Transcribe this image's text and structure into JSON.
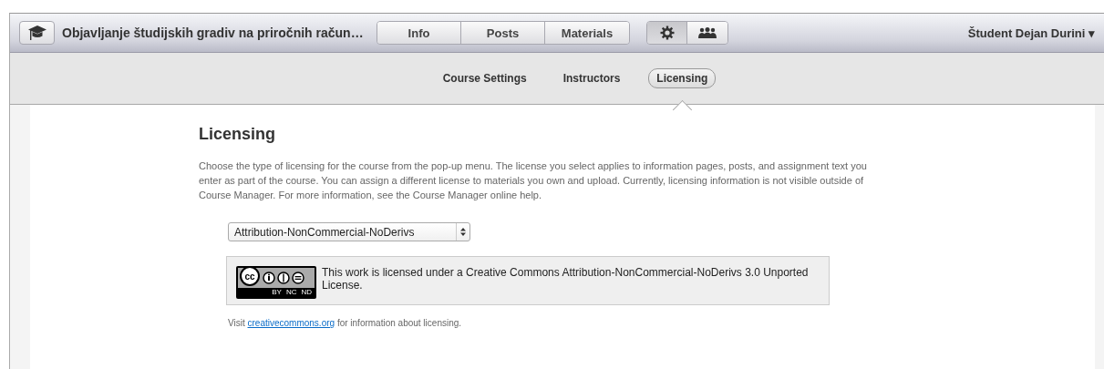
{
  "toolbar": {
    "title": "Objavljanje študijskih gradiv na priročnih račun…",
    "tabs": [
      {
        "label": "Info",
        "selected": false
      },
      {
        "label": "Posts",
        "selected": false
      },
      {
        "label": "Materials",
        "selected": false
      }
    ],
    "icon_buttons": [
      {
        "kind": "gear",
        "selected": true
      },
      {
        "kind": "people",
        "selected": false
      }
    ],
    "user": "Študent Dejan Durini ▾"
  },
  "subnav": [
    {
      "label": "Course Settings",
      "selected": false
    },
    {
      "label": "Instructors",
      "selected": false
    },
    {
      "label": "Licensing",
      "selected": true
    }
  ],
  "content": {
    "heading": "Licensing",
    "description": "Choose the type of licensing for the course from the pop-up menu. The license you select applies to information pages, posts, and assignment text you enter as part of the course. You can assign a different license to materials you own and upload. Currently, licensing information is not visible outside of Course Manager. For more information, see the Course Manager online help.",
    "license_select": "Attribution-NonCommercial-NoDerivs",
    "badge": {
      "logo": "cc",
      "labels": [
        "BY",
        "NC",
        "ND"
      ]
    },
    "license_text": "This work is licensed under a Creative Commons Attribution-NonCommercial-NoDerivs 3.0 Unported License.",
    "visit_prefix": "Visit",
    "visit_link": "creativecommons.org",
    "visit_suffix": "for information about licensing."
  }
}
